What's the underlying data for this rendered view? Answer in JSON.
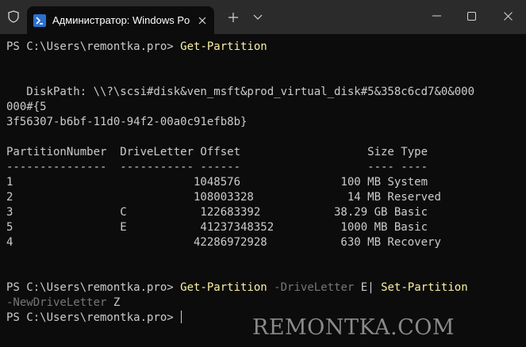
{
  "window": {
    "tab_title": "Администратор: Windows Po",
    "icons": {
      "shield": "shield-icon",
      "powershell": "powershell-icon",
      "tab_close": "close-icon",
      "new_tab": "plus-icon",
      "tab_menu": "chevron-down-icon",
      "minimize": "minimize-icon",
      "maximize": "maximize-icon",
      "close": "close-icon"
    }
  },
  "colors": {
    "background": "#0c0c0c",
    "titlebar": "#2b2b2b",
    "text": "#cccccc",
    "command": "#f9f1a5",
    "parameter": "#767676"
  },
  "terminal": {
    "prompt": "PS C:\\Users\\remontka.pro>",
    "cmd1": "Get-Partition",
    "diskpath_line1": "   DiskPath: \\\\?\\scsi#disk&ven_msft&prod_virtual_disk#5&358c6cd7&0&000",
    "diskpath_line2": "000#{5",
    "diskpath_line3": "3f56307-b6bf-11d0-94f2-00a0c91efb8b}",
    "table_header": "PartitionNumber  DriveLetter Offset                   Size Type",
    "table_separator": "---------------  ----------- ------                   ---- ----",
    "rows": [
      "1                           1048576               100 MB System",
      "2                           108003328              14 MB Reserved",
      "3                C           122683392           38.29 GB Basic",
      "5                E           41237348352          1000 MB Basic",
      "4                           42286972928           630 MB Recovery"
    ],
    "cmd2_name": "Get-Partition",
    "cmd2_param1": "-DriveLetter",
    "cmd2_value1": "E|",
    "cmd2_pipe_cmd": "Set-Partition",
    "cmd2_param2": "-NewDriveLetter",
    "cmd2_value2": "Z"
  },
  "watermark": "REMONTKA.COM"
}
